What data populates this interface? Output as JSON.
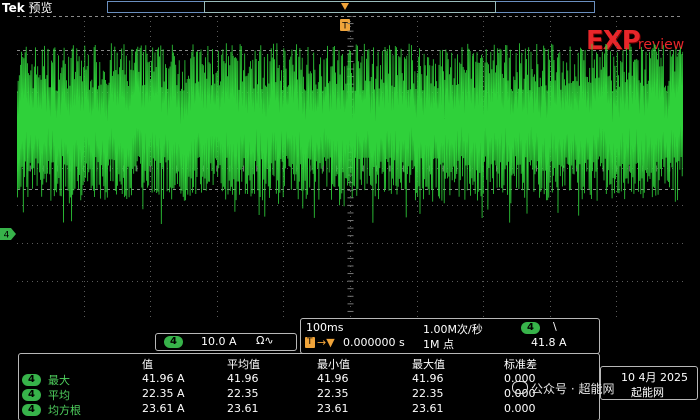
{
  "brand": {
    "name": "Tek",
    "mode": "预览"
  },
  "logo": {
    "letters": "EXP",
    "sub": "review"
  },
  "markers": {
    "trigger": "T",
    "channel": "4"
  },
  "ch4": {
    "label": "4",
    "scale": "10.0 A",
    "coupling_icon": "dc-coupling-bandwidth-icon"
  },
  "timebase": {
    "scale": "100ms",
    "sample_rate": "1.00M次/秒",
    "trigger_position": "0.000000 s",
    "record_length": "1M 点",
    "trigger_channel": "4",
    "trigger_slope": "\\",
    "trigger_level": "41.8 A"
  },
  "measurements": {
    "headers": [
      "值",
      "平均值",
      "最小值",
      "最大值",
      "标准差"
    ],
    "rows": [
      {
        "ch": "4",
        "name": "最大",
        "value": "41.96 A",
        "mean": "41.96",
        "min": "41.96",
        "max": "41.96",
        "std": "0.000"
      },
      {
        "ch": "4",
        "name": "平均",
        "value": "22.35 A",
        "mean": "22.35",
        "min": "22.35",
        "max": "22.35",
        "std": "0.000"
      },
      {
        "ch": "4",
        "name": "均方根",
        "value": "23.61 A",
        "mean": "23.61",
        "min": "23.61",
        "max": "23.61",
        "std": "0.000"
      }
    ]
  },
  "date": {
    "line1": "10 4月 2025",
    "line2": "起能网"
  },
  "watermark": {
    "text": "公众号 · 超能网"
  },
  "colors": {
    "trace": "#2fd13a",
    "grid": "#5a5a5a",
    "ch4": "#37b34a",
    "logo": "#e8262a"
  }
}
